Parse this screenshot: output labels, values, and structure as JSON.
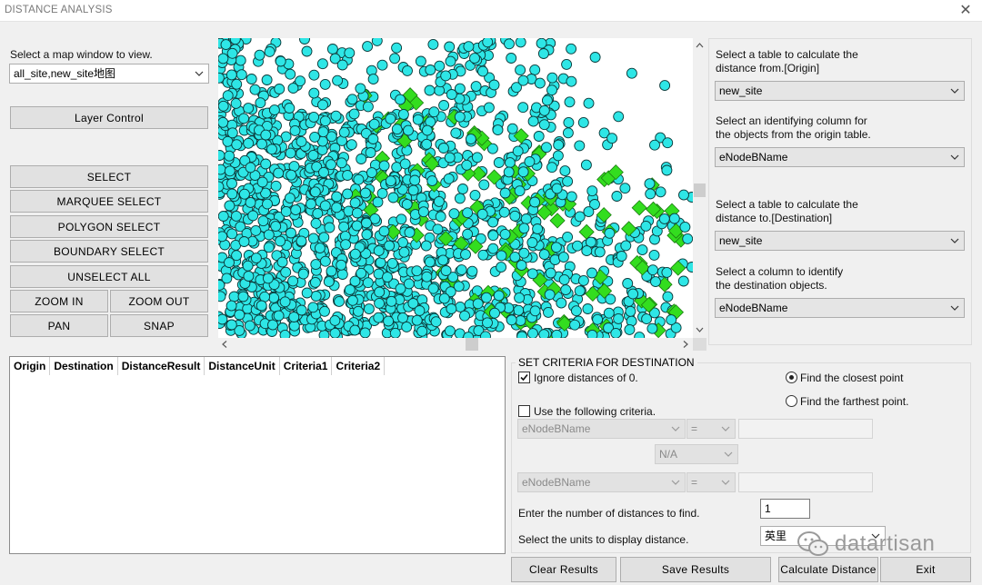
{
  "window": {
    "title": "DISTANCE ANALYSIS"
  },
  "left": {
    "map_window_label": "Select a map window to view.",
    "map_window_value": "all_site,new_site地图",
    "layer_control": "Layer Control",
    "select": "SELECT",
    "marquee_select": "MARQUEE SELECT",
    "polygon_select": "POLYGON SELECT",
    "boundary_select": "BOUNDARY SELECT",
    "unselect_all": "UNSELECT ALL",
    "zoom_in": "ZOOM IN",
    "zoom_out": "ZOOM OUT",
    "pan": "PAN",
    "snap": "SNAP"
  },
  "right": {
    "origin_table_label_1": "Select a table to calculate the",
    "origin_table_label_2": "distance from.[Origin]",
    "origin_table_value": "new_site",
    "origin_column_label_1": "Select an identifying column for",
    "origin_column_label_2": "the objects from the origin table.",
    "origin_column_value": "eNodeBName",
    "dest_table_label_1": "Select a table to calculate the",
    "dest_table_label_2": "distance to.[Destination]",
    "dest_table_value": "new_site",
    "dest_column_label_1": "Select a column to identify",
    "dest_column_label_2": "the destination objects.",
    "dest_column_value": "eNodeBName"
  },
  "results": {
    "columns": [
      "Origin",
      "Destination",
      "DistanceResult",
      "DistanceUnit",
      "Criteria1",
      "Criteria2"
    ]
  },
  "criteria": {
    "group_title": "SET CRITERIA FOR DESTINATION",
    "ignore_zero": "Ignore distances of 0.",
    "ignore_zero_checked": true,
    "use_criteria": "Use the following criteria.",
    "use_criteria_checked": false,
    "closest": "Find the closest point",
    "farthest": "Find the farthest point.",
    "selected_mode": "closest",
    "crit1_field": "eNodeBName",
    "crit1_op": "=",
    "crit1_value": "",
    "logic_op": "N/A",
    "crit2_field": "eNodeBName",
    "crit2_op": "=",
    "crit2_value": "",
    "num_label": "Enter the number of distances to find.",
    "num_value": "1",
    "units_label": "Select the units to display distance.",
    "units_value": "英里"
  },
  "buttons": {
    "clear": "Clear Results",
    "save": "Save Results",
    "calculate": "Calculate Distance",
    "exit": "Exit"
  },
  "watermark": {
    "text": "datartisan"
  },
  "colors": {
    "site_fill": "#2ee6e6",
    "new_site_fill": "#33dd1f",
    "point_stroke": "#0a3a3a"
  },
  "icons": {
    "close": "close-icon",
    "dropdown": "chevron-down-icon",
    "scroll_up": "scroll-up-arrow",
    "scroll_down": "scroll-down-arrow",
    "scroll_left": "scroll-left-arrow",
    "scroll_right": "scroll-right-arrow",
    "watermark": "wechat-icon"
  }
}
